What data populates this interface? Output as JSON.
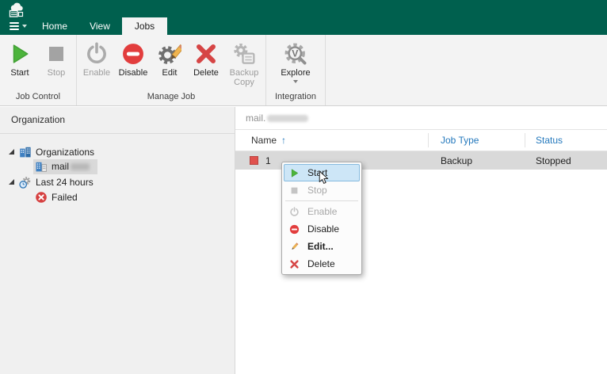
{
  "colors": {
    "brand_green": "#00604E",
    "accent_blue": "#2579BD",
    "danger_red": "#D64545",
    "start_green": "#4CB43C",
    "selection_gray": "#D9D9D9",
    "menu_highlight": "#CDE6F7"
  },
  "tabs": {
    "items": [
      {
        "label": "Home"
      },
      {
        "label": "View"
      },
      {
        "label": "Jobs"
      }
    ],
    "active": "Jobs"
  },
  "ribbon": {
    "groups": [
      {
        "label": "Job Control",
        "buttons": [
          {
            "label": "Start",
            "icon": "start-play-icon",
            "enabled": true
          },
          {
            "label": "Stop",
            "icon": "stop-square-icon",
            "enabled": false
          }
        ]
      },
      {
        "label": "Manage Job",
        "buttons": [
          {
            "label": "Enable",
            "icon": "power-icon",
            "enabled": false
          },
          {
            "label": "Disable",
            "icon": "disable-icon",
            "enabled": true
          },
          {
            "label": "Edit",
            "icon": "edit-gear-pencil-icon",
            "enabled": true
          },
          {
            "label": "Delete",
            "icon": "delete-x-icon",
            "enabled": true
          },
          {
            "label": "Backup Copy",
            "icon": "backup-copy-icon",
            "enabled": false
          }
        ]
      },
      {
        "label": "Integration",
        "buttons": [
          {
            "label": "Explore",
            "icon": "explore-icon",
            "enabled": true,
            "has_dropdown": true
          }
        ]
      }
    ]
  },
  "sidebar": {
    "header": "Organization",
    "tree": [
      {
        "label": "Organizations",
        "icon": "organizations-icon",
        "level": 0,
        "expanded": true
      },
      {
        "label": "mail",
        "icon": "organization-icon",
        "level": 1,
        "selected": true,
        "redacted_suffix": true
      },
      {
        "label": "Last 24 hours",
        "icon": "last-24-hours-icon",
        "level": 0,
        "expanded": true
      },
      {
        "label": "Failed",
        "icon": "failed-icon",
        "level": 1
      }
    ]
  },
  "main": {
    "breadcrumb": "mail.",
    "breadcrumb_redacted": true,
    "table": {
      "sort_arrow": "↑",
      "columns": [
        {
          "label": "Name",
          "sorted": "asc"
        },
        {
          "label": "Job Type"
        },
        {
          "label": "Status"
        }
      ],
      "rows": [
        {
          "name": "1",
          "icon": "job-red-square-icon",
          "job_type": "Backup",
          "status": "Stopped"
        }
      ]
    }
  },
  "context_menu": {
    "items": [
      {
        "label": "Start",
        "icon": "start-play-icon",
        "enabled": true,
        "highlighted": true
      },
      {
        "label": "Stop",
        "icon": "stop-square-icon",
        "enabled": false
      },
      {
        "label": "Enable",
        "icon": "power-icon",
        "enabled": false,
        "separator_before": true
      },
      {
        "label": "Disable",
        "icon": "disable-icon",
        "enabled": true
      },
      {
        "label": "Edit...",
        "icon": "pencil-icon",
        "enabled": true,
        "bold": true
      },
      {
        "label": "Delete",
        "icon": "delete-x-icon",
        "enabled": true
      }
    ]
  }
}
